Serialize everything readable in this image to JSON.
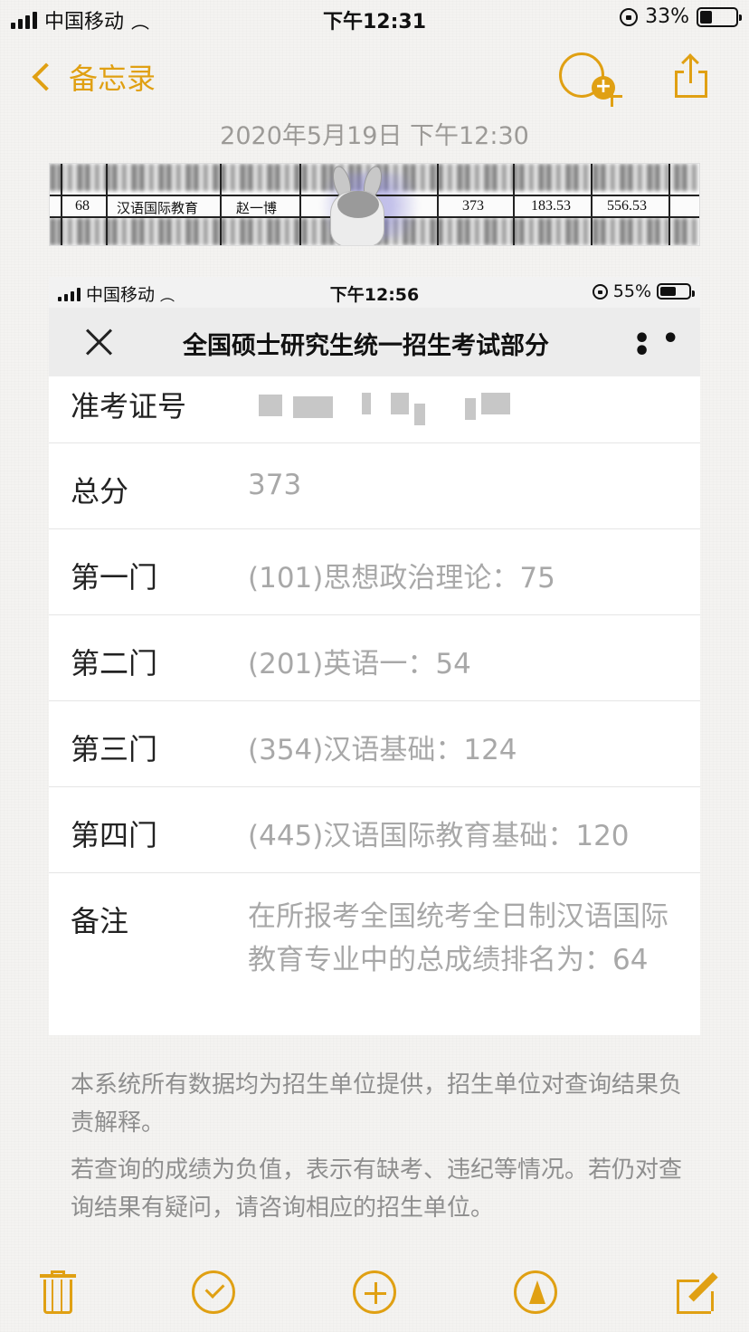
{
  "status_bar": {
    "carrier": "中国移动",
    "time": "下午12:31",
    "battery": "33%",
    "battery_level": 0.33
  },
  "nav": {
    "back_label": "备忘录"
  },
  "note": {
    "date": "2020年5月19日 下午12:30"
  },
  "attached_table": {
    "row": [
      "68",
      "汉语国际教育",
      "赵一博",
      "373",
      "183.53",
      "556.53"
    ]
  },
  "inner_screenshot": {
    "status_bar": {
      "carrier": "中国移动",
      "time": "下午12:56",
      "battery": "55%",
      "battery_level": 0.55
    },
    "title": "全国硕士研究生统一招生考试部分",
    "rows": [
      {
        "key": "准考证号",
        "value": ""
      },
      {
        "key": "总分",
        "value": "373"
      },
      {
        "key": "第一门",
        "value": "(101)思想政治理论：75"
      },
      {
        "key": "第二门",
        "value": "(201)英语一：54"
      },
      {
        "key": "第三门",
        "value": "(354)汉语基础：124"
      },
      {
        "key": "第四门",
        "value": "(445)汉语国际教育基础：120"
      },
      {
        "key": "备注",
        "value": "在所报考全国统考全日制汉语国际教育专业中的总成绩排名为：64"
      }
    ],
    "footnotes": [
      "本系统所有数据均为招生单位提供，招生单位对查询结果负责解释。",
      "若查询的成绩为负值，表示有缺考、违纪等情况。若仍对查询结果有疑问，请咨询相应的招生单位。"
    ]
  },
  "colors": {
    "accent": "#e0a013",
    "background": "#f4f3f1"
  },
  "icons": [
    "trash-icon",
    "checklist-icon",
    "add-icon",
    "sketch-icon",
    "compose-icon"
  ]
}
